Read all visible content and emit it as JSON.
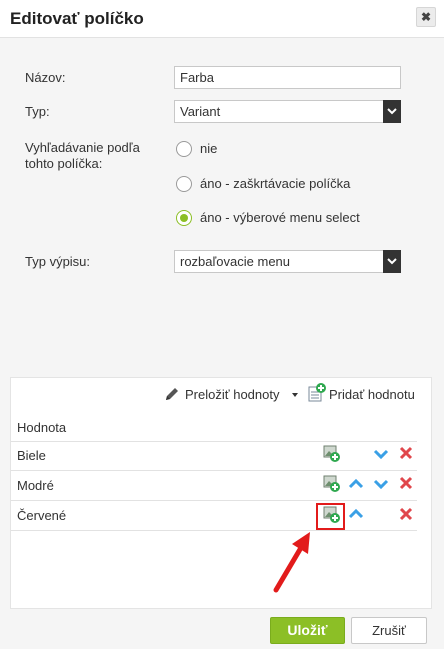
{
  "dialog": {
    "title": "Editovať políčko",
    "close_glyph": "✖"
  },
  "form": {
    "name_label": "Názov:",
    "name_value": "Farba",
    "type_label": "Typ:",
    "type_value": "Variant",
    "search_label_line1": "Vyhľadávanie podľa",
    "search_label_line2": "tohto políčka:",
    "search_options": [
      {
        "label": "nie",
        "selected": false
      },
      {
        "label": "áno - zaškrtávacie políčka",
        "selected": false
      },
      {
        "label": "áno - výberové menu select",
        "selected": true
      }
    ],
    "listing_label": "Typ výpisu:",
    "listing_value": "rozbaľovacie menu"
  },
  "values_panel": {
    "translate_label": "Preložiť hodnoty",
    "add_label": "Pridať hodnotu",
    "column_header": "Hodnota",
    "rows": [
      {
        "name": "Biele",
        "up": false,
        "down": true
      },
      {
        "name": "Modré",
        "up": true,
        "down": true
      },
      {
        "name": "Červené",
        "up": true,
        "down": false
      }
    ]
  },
  "footer": {
    "save_label": "Uložiť",
    "cancel_label": "Zrušiť"
  },
  "colors": {
    "accent_green": "#8cbf26",
    "arrow_blue": "#3aa0e6",
    "delete_red": "#e0474c",
    "annotation_red": "#e21b1b"
  }
}
